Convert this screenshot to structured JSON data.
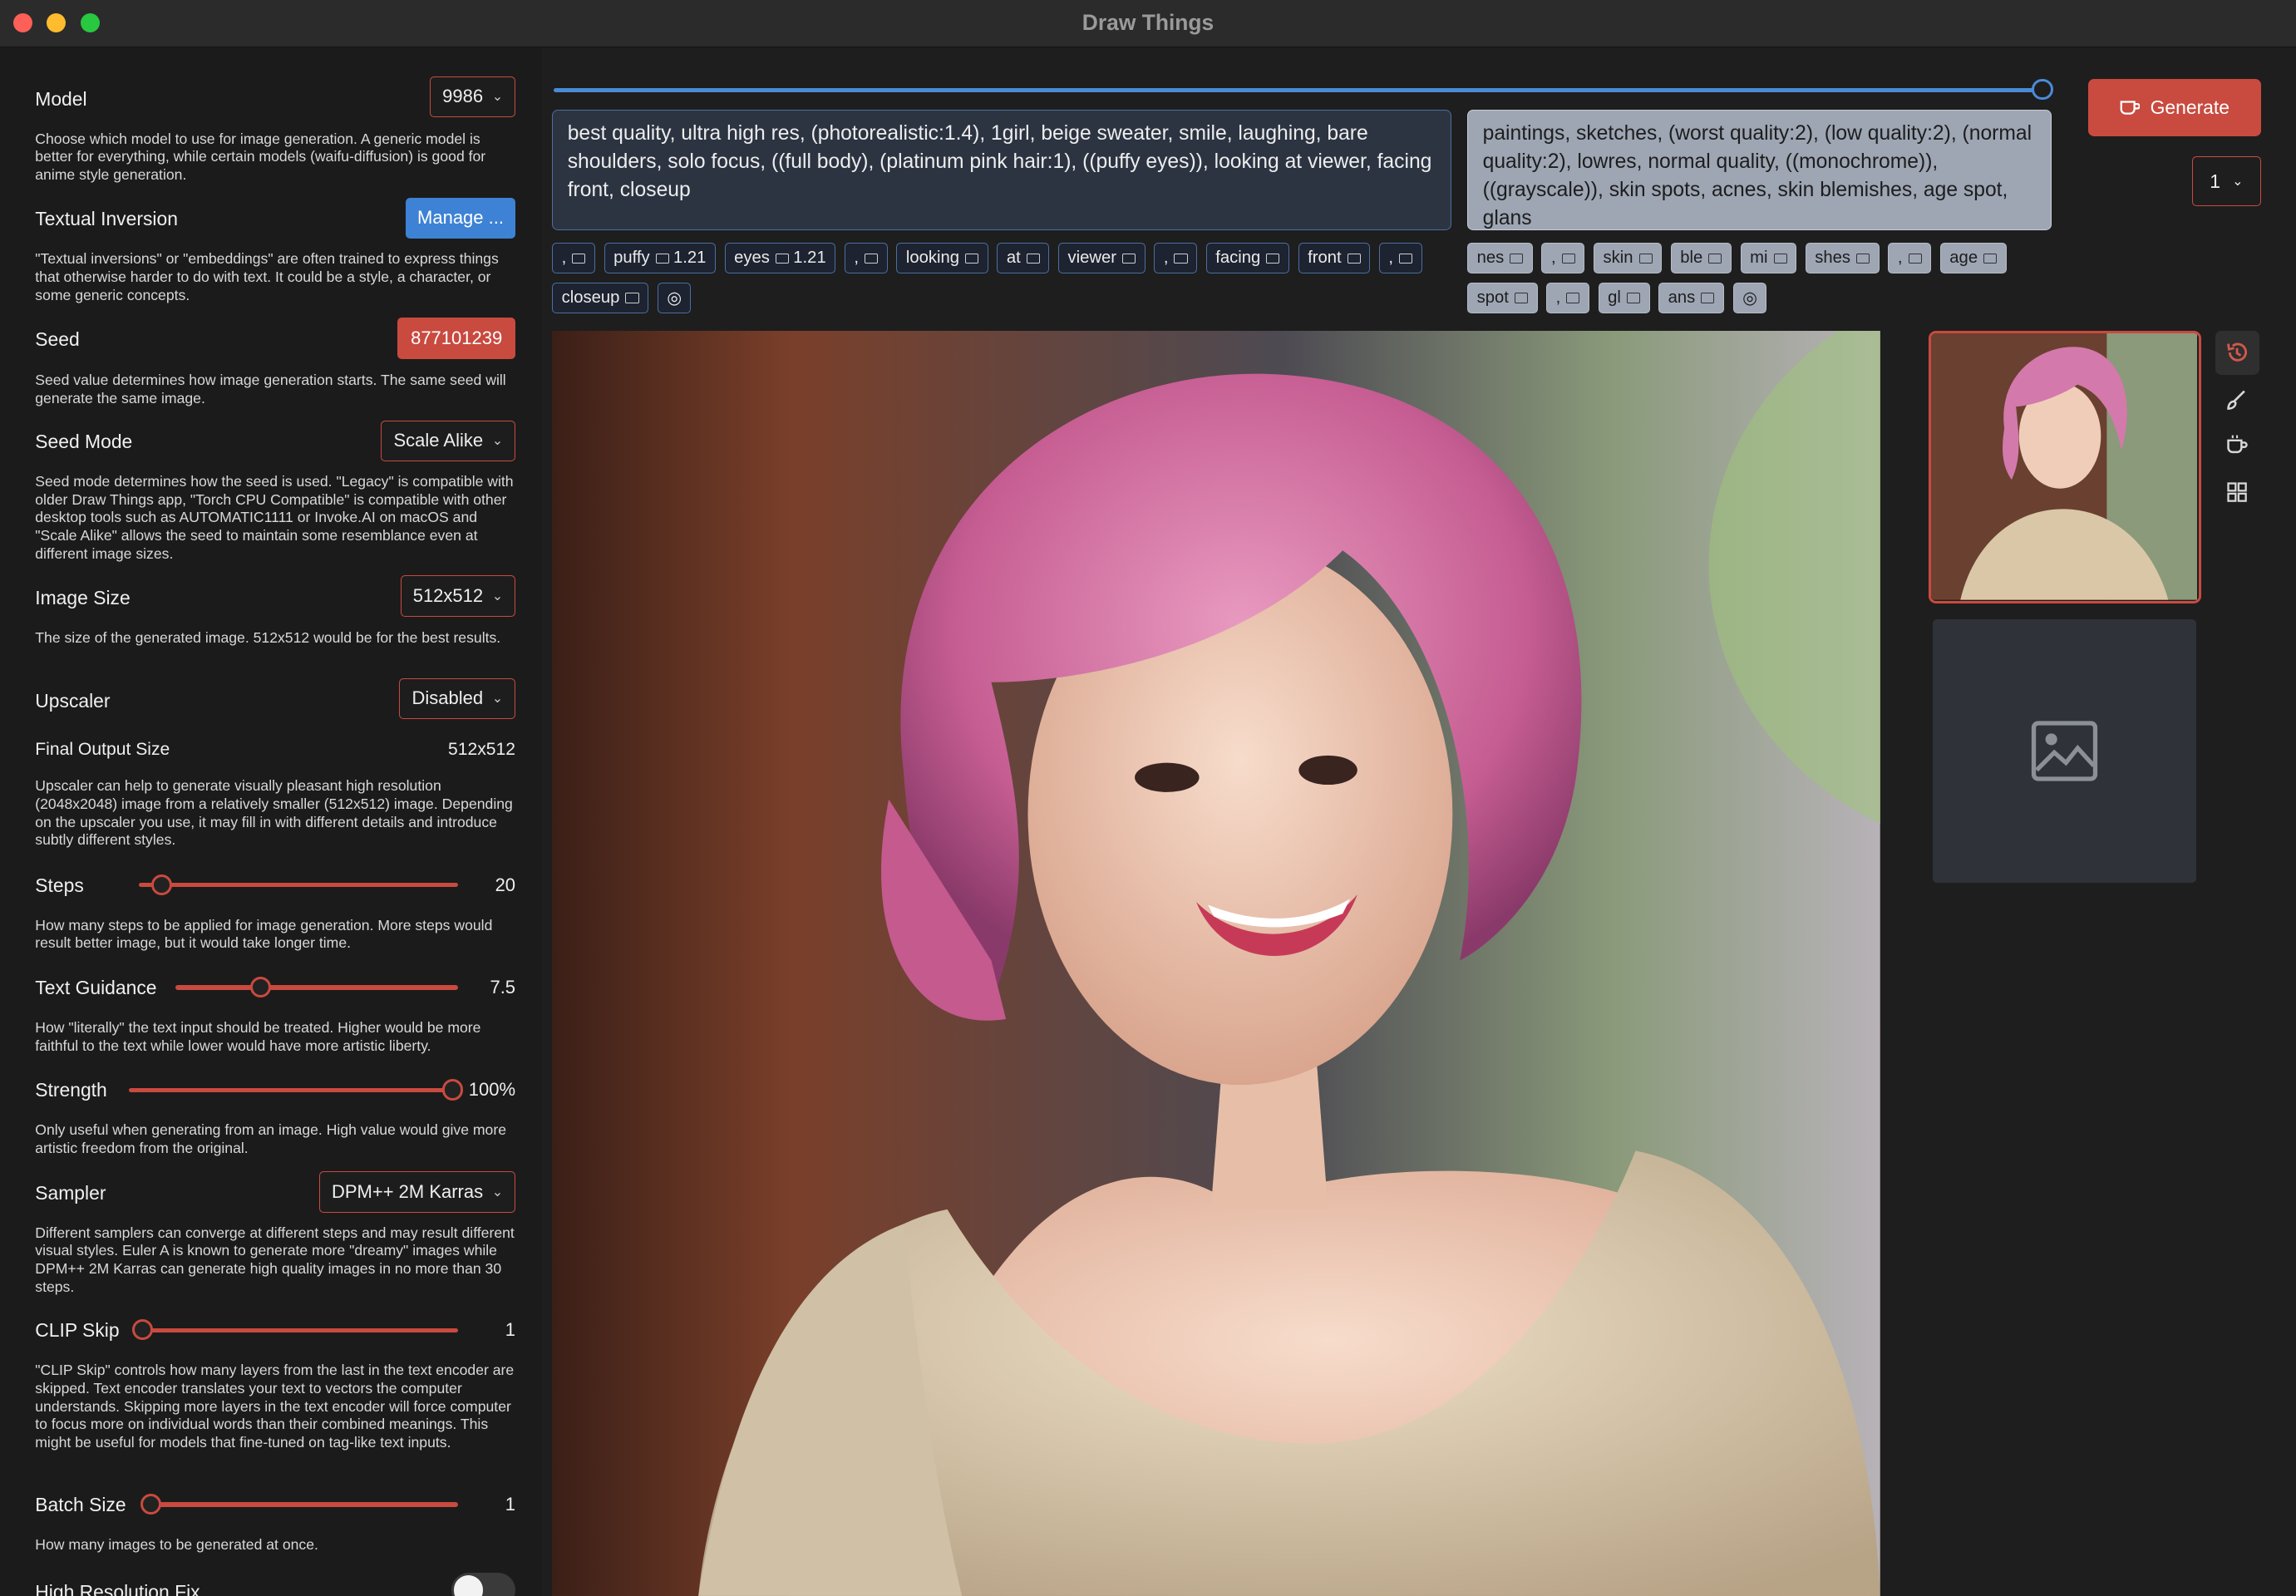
{
  "window": {
    "title": "Draw Things"
  },
  "settings": {
    "model": {
      "label": "Model",
      "value": "9986",
      "desc": "Choose which model to use for image generation. A generic model is better for everything, while certain models (waifu-diffusion) is good for anime style generation."
    },
    "textual_inversion": {
      "label": "Textual Inversion",
      "button": "Manage ...",
      "desc": "\"Textual inversions\" or \"embeddings\" are often trained to express things that otherwise harder to do with text. It could be a style, a character, or some generic concepts."
    },
    "seed": {
      "label": "Seed",
      "value": "877101239",
      "desc": "Seed value determines how image generation starts. The same seed will generate the same image."
    },
    "seed_mode": {
      "label": "Seed Mode",
      "value": "Scale Alike",
      "desc": "Seed mode determines how the seed is used. \"Legacy\" is compatible with older Draw Things app, \"Torch CPU Compatible\" is compatible with other desktop tools such as AUTOMATIC1111 or Invoke.AI on macOS and \"Scale Alike\" allows the seed to maintain some resemblance even at different image sizes."
    },
    "image_size": {
      "label": "Image Size",
      "value": "512x512",
      "desc": "The size of the generated image. 512x512 would be for the best results."
    },
    "upscaler": {
      "label": "Upscaler",
      "value": "Disabled"
    },
    "final_output": {
      "label": "Final Output Size",
      "value": "512x512",
      "desc": "Upscaler can help to generate visually pleasant high resolution (2048x2048) image from a relatively smaller (512x512) image. Depending on the upscaler you use, it may fill in with different details and introduce subtly different styles."
    },
    "steps": {
      "label": "Steps",
      "value": "20",
      "level": 0.07,
      "desc": "How many steps to be applied for image generation. More steps would result better image, but it would take longer time."
    },
    "text_guidance": {
      "label": "Text Guidance",
      "value": "7.5",
      "level": 0.3,
      "desc": "How \"literally\" the text input should be treated. Higher would be more faithful to the text while lower would have more artistic liberty."
    },
    "strength": {
      "label": "Strength",
      "value": "100%",
      "level": 1.0,
      "desc": "Only useful when generating from an image. High value would give more artistic freedom from the original."
    },
    "sampler": {
      "label": "Sampler",
      "value": "DPM++ 2M Karras",
      "desc": "Different samplers can converge at different steps and may result different visual styles. Euler A is known to generate more \"dreamy\" images while DPM++ 2M Karras can generate high quality images in no more than 30 steps."
    },
    "clip_skip": {
      "label": "CLIP Skip",
      "value": "1",
      "level": 0.0,
      "desc": "\"CLIP Skip\" controls how many layers from the last in the text encoder are skipped. Text encoder translates your text to vectors the computer understands. Skipping more layers in the text encoder will force computer to focus more on individual words than their combined meanings. This might be useful for models that fine-tuned on tag-like text inputs."
    },
    "batch_size": {
      "label": "Batch Size",
      "value": "1",
      "level": 0.0,
      "desc": "How many images to be generated at once."
    },
    "hires_fix": {
      "label": "High Resolution Fix",
      "enabled": false
    }
  },
  "prompt": {
    "positive": "best quality, ultra high res, (photorealistic:1.4), 1girl, beige sweater, smile, laughing, bare shoulders, solo focus, ((full body), (platinum pink hair:1), ((puffy eyes)), looking at viewer, facing front, closeup",
    "negative": "paintings, sketches, (worst quality:2), (low quality:2), (normal quality:2), lowres, normal quality, ((monochrome)), ((grayscale)), skin spots, acnes, skin blemishes, age spot, glans",
    "positive_tags": [
      ",",
      "puffy",
      "eyes",
      ",",
      "looking",
      "at",
      "viewer",
      ",",
      "facing",
      "front",
      ",",
      "closeup"
    ],
    "positive_tag_weights": [
      "",
      "1.21",
      "1.21",
      "",
      "",
      "",
      "",
      "",
      "",
      "",
      "",
      ""
    ],
    "negative_tags": [
      "nes",
      ",",
      "skin",
      "ble",
      "mi",
      "shes",
      ",",
      "age",
      "spot",
      ",",
      "gl",
      "ans"
    ]
  },
  "toolbar": {
    "generate": "Generate",
    "batch_count": "1"
  },
  "progress": 1.0,
  "icons": {
    "history": "history-icon",
    "brush": "brush-icon",
    "coffee": "coffee-icon",
    "grid": "grid-icon",
    "placeholder": "image-placeholder-icon"
  }
}
